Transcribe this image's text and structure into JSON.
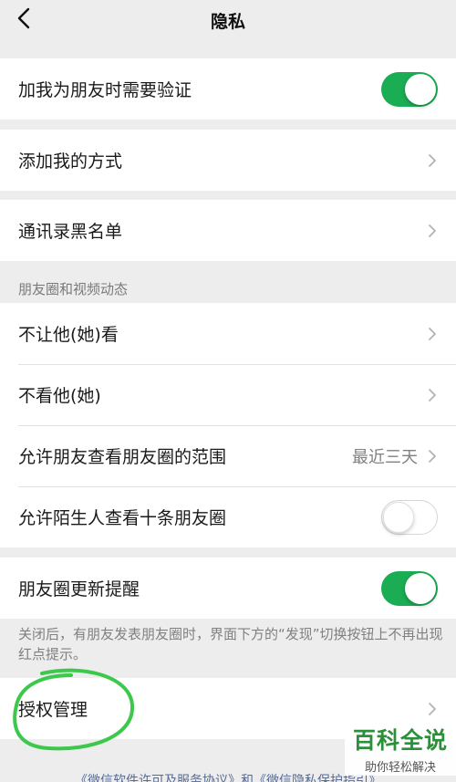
{
  "nav": {
    "title": "隐私"
  },
  "group1": {
    "verify_label": "加我为朋友时需要验证",
    "verify_on": true
  },
  "group2": {
    "add_methods_label": "添加我的方式"
  },
  "group3": {
    "blacklist_label": "通讯录黑名单"
  },
  "moments": {
    "header": "朋友圈和视频动态",
    "hide_from_label": "不让他(她)看",
    "hide_their_label": "不看他(她)",
    "range_label": "允许朋友查看朋友圈的范围",
    "range_value": "最近三天",
    "strangers_label": "允许陌生人查看十条朋友圈",
    "strangers_on": false
  },
  "reminder": {
    "label": "朋友圈更新提醒",
    "on": true,
    "note": "关闭后，有朋友发表朋友圈时，界面下方的“发现”切换按钮上不再出现红点提示。"
  },
  "auth": {
    "label": "授权管理"
  },
  "footer": {
    "text": "《微信软件许可及服务协议》和《微信隐私保护指引》"
  },
  "watermark": {
    "brand": "百科全说",
    "sub": "助你轻松解决"
  },
  "colors": {
    "accent": "#1aad53",
    "background": "#ededed",
    "annotation": "#3cc84a"
  }
}
